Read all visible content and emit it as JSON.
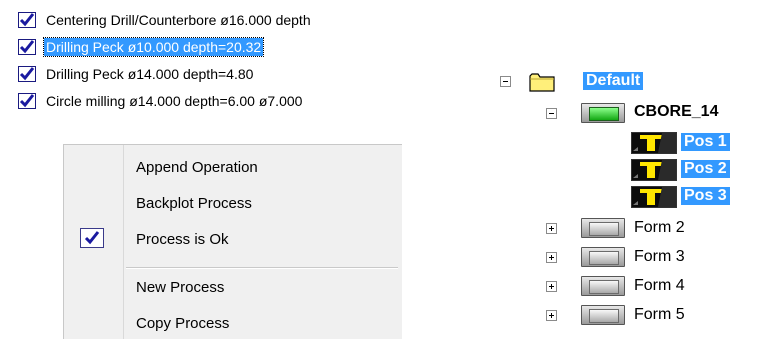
{
  "operations": [
    {
      "label": "Centering Drill/Counterbore ø16.000 depth",
      "checked": true,
      "selected": false
    },
    {
      "label": "Drilling Peck ø10.000 depth=20.32",
      "checked": true,
      "selected": true
    },
    {
      "label": "Drilling Peck ø14.000 depth=4.80",
      "checked": true,
      "selected": false
    },
    {
      "label": "Circle milling ø14.000 depth=6.00 ø7.000",
      "checked": true,
      "selected": false
    }
  ],
  "context_menu": {
    "items": [
      {
        "label": "Append Operation"
      },
      {
        "label": "Backplot Process"
      },
      {
        "label": "Process is Ok",
        "checked": true
      },
      {
        "label": "New Process"
      },
      {
        "label": "Copy Process"
      }
    ]
  },
  "tree": {
    "root": {
      "label": "Default",
      "expanded": true
    },
    "cbore": {
      "label": "CBORE_14",
      "expanded": true
    },
    "positions": [
      {
        "label": "Pos 1"
      },
      {
        "label": "Pos 2"
      },
      {
        "label": "Pos 3"
      }
    ],
    "forms": [
      {
        "label": "Form 2"
      },
      {
        "label": "Form 3"
      },
      {
        "label": "Form 4"
      },
      {
        "label": "Form 5"
      }
    ]
  },
  "colors": {
    "selection": "#3399ff",
    "check": "#1a1aa0",
    "active_button": "#22c222"
  }
}
